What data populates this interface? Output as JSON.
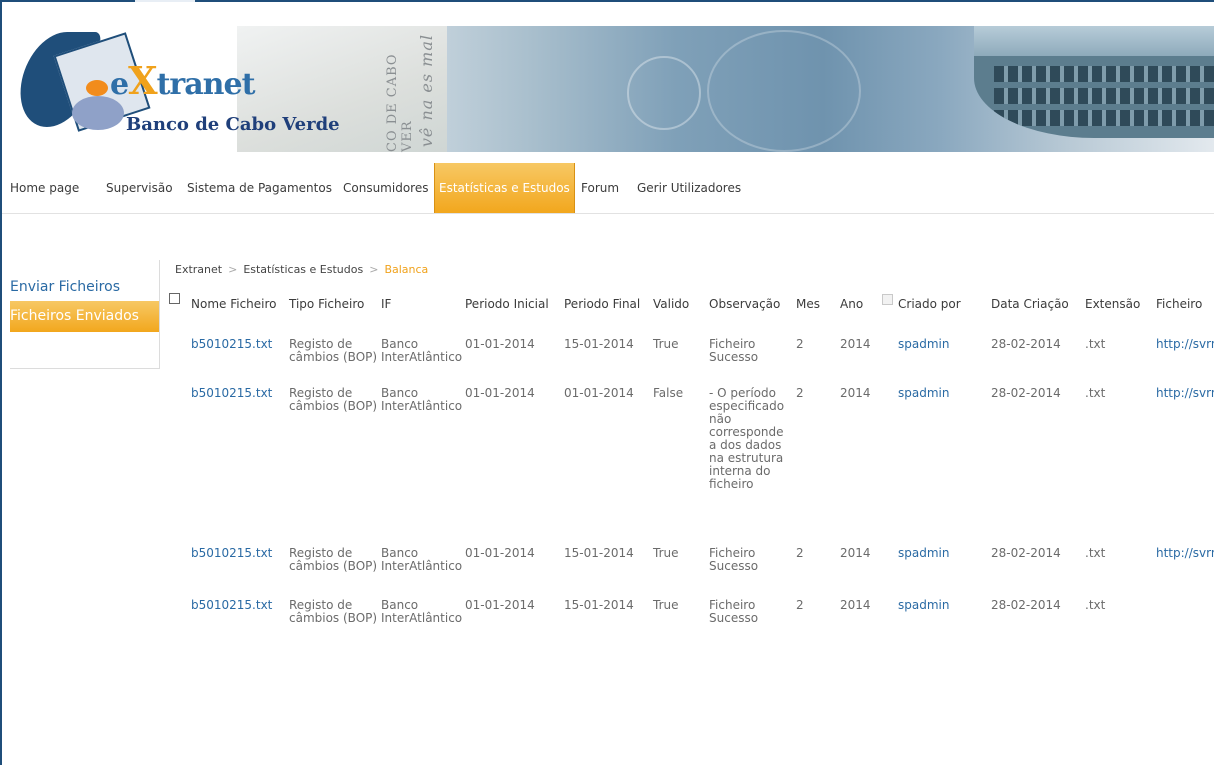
{
  "branding": {
    "title_prefix": "e",
    "title_x": "X",
    "title_suffix": "tranet",
    "subtitle": "Banco de Cabo Verde"
  },
  "nav": {
    "items": [
      {
        "label": "Home page"
      },
      {
        "label": "Supervisão"
      },
      {
        "label": "Sistema de Pagamentos"
      },
      {
        "label": "Consumidores"
      },
      {
        "label": "Estatísticas e Estudos",
        "active": true
      },
      {
        "label": "Forum"
      },
      {
        "label": "Gerir Utilizadores"
      }
    ]
  },
  "sidebar": {
    "items": [
      {
        "label": "Enviar Ficheiros"
      },
      {
        "label": "Ficheiros Enviados",
        "active": true
      }
    ]
  },
  "breadcrumb": {
    "items": [
      "Extranet",
      "Estatísticas e Estudos",
      "Balanca"
    ]
  },
  "table": {
    "columns": [
      "Nome Ficheiro",
      "Tipo Ficheiro",
      "IF",
      "Periodo Inicial",
      "Periodo Final",
      "Valido",
      "Observação",
      "Mes",
      "Ano",
      "Criado por",
      "Data Criação",
      "Extensão",
      "Ficheiro"
    ],
    "rows": [
      {
        "nome": "b5010215.txt",
        "tipo": "Registo de\ncâmbios (BOP)",
        "if": "Banco\nInterAtlântico",
        "inicio": "01-01-2014",
        "fim": "15-01-2014",
        "valido": "True",
        "obs": "Ficheiro\nSucesso",
        "mes": "2",
        "ano": "2014",
        "criado": "spadmin",
        "data": "28-02-2014",
        "ext": ".txt",
        "ficheiro": "http://svrn"
      },
      {
        "nome": "b5010215.txt",
        "tipo": "Registo de\ncâmbios (BOP)",
        "if": "Banco\nInterAtlântico",
        "inicio": "01-01-2014",
        "fim": "01-01-2014",
        "valido": "False",
        "obs": " - O período\nespecificado\nnão\ncorresponde\na dos dados\nna estrutura\ninterna do\nficheiro",
        "mes": "2",
        "ano": "2014",
        "criado": "spadmin",
        "data": "28-02-2014",
        "ext": ".txt",
        "ficheiro": "http://svrn"
      },
      {
        "nome": "b5010215.txt",
        "tipo": "Registo de\ncâmbios (BOP)",
        "if": "Banco\nInterAtlântico",
        "inicio": "01-01-2014",
        "fim": "15-01-2014",
        "valido": "True",
        "obs": "Ficheiro\nSucesso",
        "mes": "2",
        "ano": "2014",
        "criado": "spadmin",
        "data": "28-02-2014",
        "ext": ".txt",
        "ficheiro": "http://svrn"
      },
      {
        "nome": "b5010215.txt",
        "tipo": "Registo de\ncâmbios (BOP)",
        "if": "Banco\nInterAtlântico",
        "inicio": "01-01-2014",
        "fim": "15-01-2014",
        "valido": "True",
        "obs": "Ficheiro\nSucesso",
        "mes": "2",
        "ano": "2014",
        "criado": "spadmin",
        "data": "28-02-2014",
        "ext": ".txt",
        "ficheiro": ""
      }
    ]
  },
  "colors": {
    "accent": "#f2a71d",
    "link": "#2a6aa4",
    "frame": "#1f4e7a"
  }
}
